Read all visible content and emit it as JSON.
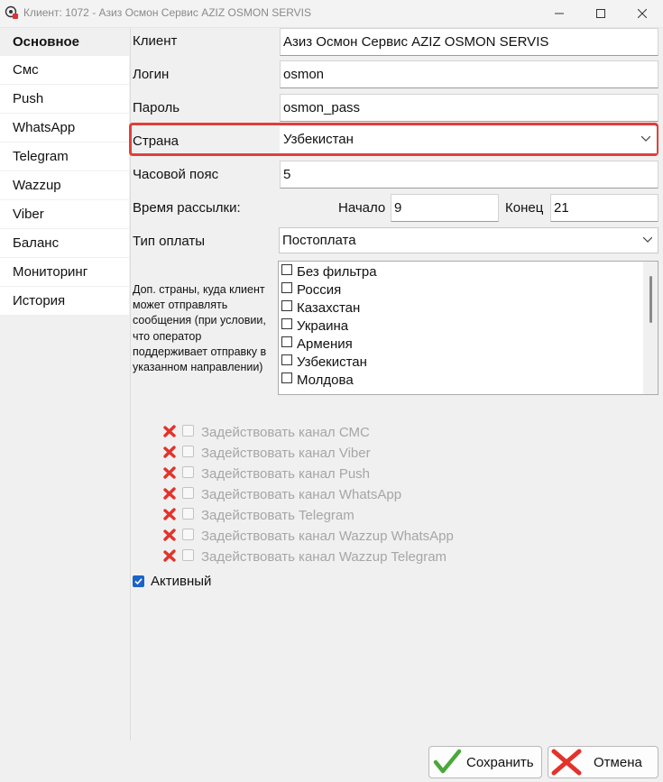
{
  "window": {
    "title": "Клиент: 1072 - Азиз Осмон Сервис AZIZ OSMON SERVIS",
    "buttons": [
      "minimize",
      "maximize",
      "close"
    ]
  },
  "sidebar": {
    "items": [
      {
        "label": "Основное",
        "active": true
      },
      {
        "label": "Смс"
      },
      {
        "label": "Push"
      },
      {
        "label": "WhatsApp"
      },
      {
        "label": "Telegram"
      },
      {
        "label": "Wazzup"
      },
      {
        "label": "Viber"
      },
      {
        "label": "Баланс"
      },
      {
        "label": "Мониторинг"
      },
      {
        "label": "История"
      }
    ]
  },
  "form": {
    "client": {
      "label": "Клиент",
      "value": "Азиз Осмон Сервис AZIZ OSMON SERVIS"
    },
    "login": {
      "label": "Логин",
      "value": "osmon"
    },
    "password": {
      "label": "Пароль",
      "value": "osmon_pass"
    },
    "country": {
      "label": "Страна",
      "value": "Узбекистан",
      "highlight_color": "#e0403a"
    },
    "timezone": {
      "label": "Часовой пояс",
      "value": "5"
    },
    "send_time": {
      "label": "Время рассылки:",
      "start_label": "Начало",
      "start_value": "9",
      "end_label": "Конец",
      "end_value": "21"
    },
    "payment": {
      "label": "Тип оплаты",
      "value": "Постоплата"
    },
    "extra_countries": {
      "note": "Доп. страны, куда клиент может отправлять сообщения (при условии, что оператор поддерживает отправку в указанном направлении)",
      "items": [
        "Без фильтра",
        "Россия",
        "Казахстан",
        "Украина",
        "Армения",
        "Узбекистан",
        "Молдова"
      ]
    },
    "channels": [
      "Задействовать канал СМС",
      "Задействовать канал Viber",
      "Задействовать канал Push",
      "Задействовать канал WhatsApp",
      "Задействовать Telegram",
      "Задействовать канал Wazzup WhatsApp",
      "Задействовать канал Wazzup Telegram"
    ],
    "active": {
      "label": "Активный",
      "checked": true
    }
  },
  "footer": {
    "save_label": "Сохранить",
    "cancel_label": "Отмена"
  },
  "colors": {
    "accent": "#1c63c7",
    "danger": "#e0403a",
    "disabled_text": "#a6a6a6"
  }
}
